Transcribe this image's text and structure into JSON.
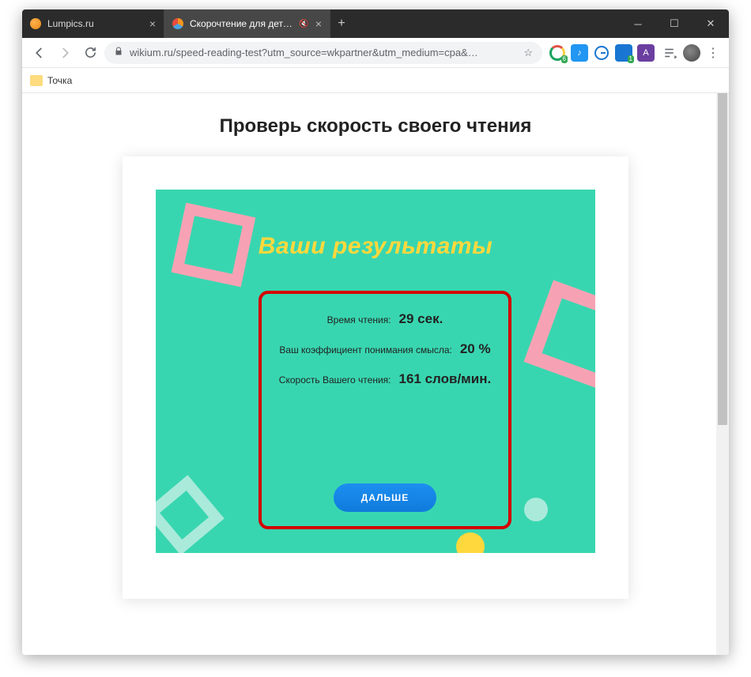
{
  "window": {
    "tab1": {
      "title": "Lumpics.ru"
    },
    "tab2": {
      "title": "Скорочтение для детей и вз"
    }
  },
  "address": {
    "url": "wikium.ru/speed-reading-test?utm_source=wkpartner&utm_medium=cpa&…"
  },
  "bookmarks": {
    "item1": "Точка"
  },
  "ext_badges": {
    "e1": "6",
    "e4": "1"
  },
  "page": {
    "heading": "Проверь скорость своего чтения",
    "hero_title": "Ваши результаты",
    "results": {
      "time_label": "Время чтения:",
      "time_value": "29 сек.",
      "comprehension_label": "Ваш коэффициент понимания смысла:",
      "comprehension_value": "20 %",
      "speed_label": "Скорость Вашего чтения:",
      "speed_value": "161 слов/мин."
    },
    "next_button": "ДАЛЬШЕ"
  }
}
